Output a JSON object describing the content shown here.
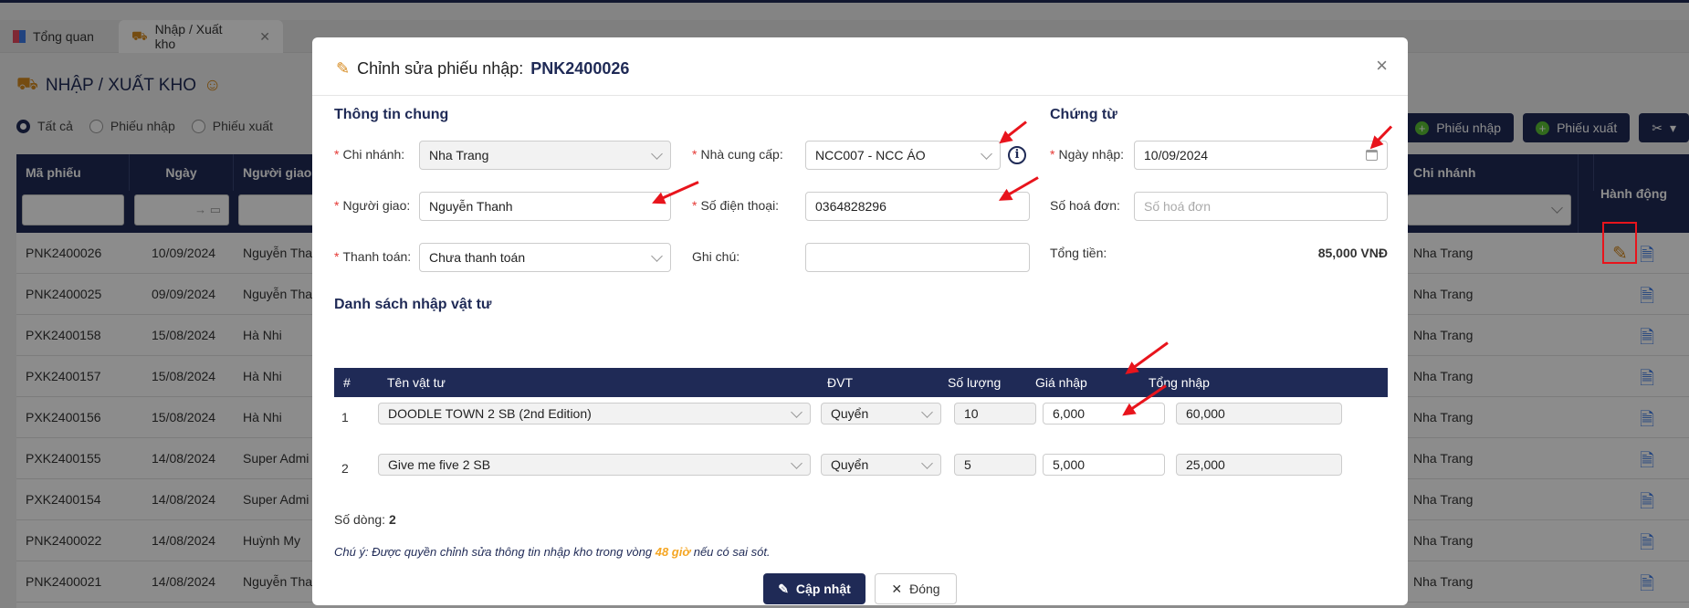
{
  "tabs": [
    {
      "label": "Tổng quan"
    },
    {
      "label": "Nhập / Xuất kho"
    }
  ],
  "page": {
    "title": "NHẬP / XUẤT KHO"
  },
  "filters": {
    "radio_all": "Tất cả",
    "radio_import": "Phiếu nhập",
    "radio_export": "Phiếu xuất"
  },
  "toolbar": {
    "import_label": "Phiếu nhập",
    "export_label": "Phiếu xuất"
  },
  "table": {
    "columns": [
      "Mã phiếu",
      "Ngày",
      "Người giao",
      "Chi nhánh",
      "Hành động"
    ],
    "rows": [
      {
        "code": "PNK2400026",
        "date": "10/09/2024",
        "person": "Nguyễn Tha",
        "branch": "Nha Trang"
      },
      {
        "code": "PNK2400025",
        "date": "09/09/2024",
        "person": "Nguyễn Tha",
        "branch": "Nha Trang"
      },
      {
        "code": "PXK2400158",
        "date": "15/08/2024",
        "person": "Hà Nhi",
        "branch": "Nha Trang"
      },
      {
        "code": "PXK2400157",
        "date": "15/08/2024",
        "person": "Hà Nhi",
        "branch": "Nha Trang"
      },
      {
        "code": "PXK2400156",
        "date": "15/08/2024",
        "person": "Hà Nhi",
        "branch": "Nha Trang"
      },
      {
        "code": "PXK2400155",
        "date": "14/08/2024",
        "person": "Super Admi",
        "branch": "Nha Trang"
      },
      {
        "code": "PXK2400154",
        "date": "14/08/2024",
        "person": "Super Admi",
        "branch": "Nha Trang"
      },
      {
        "code": "PNK2400022",
        "date": "14/08/2024",
        "person": "Huỳnh My",
        "branch": "Nha Trang"
      },
      {
        "code": "PNK2400021",
        "date": "14/08/2024",
        "person": "Nguyễn Tha",
        "branch": "Nha Trang"
      }
    ]
  },
  "modal": {
    "title": "Chỉnh sửa phiếu nhập:",
    "code": "PNK2400026",
    "section_general": "Thông tin chung",
    "section_docs": "Chứng từ",
    "labels": {
      "branch": "Chi nhánh:",
      "supplier": "Nhà cung cấp:",
      "date": "Ngày nhập:",
      "deliverer": "Người giao:",
      "phone": "Số điện thoại:",
      "invoice": "Số hoá đơn:",
      "payment": "Thanh toán:",
      "note": "Ghi chú:",
      "total": "Tổng tiền:"
    },
    "values": {
      "branch": "Nha Trang",
      "supplier": "NCC007 - NCC ÁO",
      "date": "10/09/2024",
      "deliverer": "Nguyễn Thanh",
      "phone": "0364828296",
      "invoice_placeholder": "Số hoá đơn",
      "payment": "Chưa thanh toán",
      "note": "",
      "total": "85,000 VNĐ"
    },
    "items_title": "Danh sách nhập vật tư",
    "items_columns": [
      "#",
      "Tên vật tư",
      "ĐVT",
      "Số lượng",
      "Giá nhập",
      "Tổng nhập"
    ],
    "items": [
      {
        "no": "1",
        "name": "DOODLE TOWN 2 SB (2nd Edition)",
        "unit": "Quyển",
        "qty": "10",
        "price": "6,000",
        "total": "60,000"
      },
      {
        "no": "2",
        "name": "Give me five 2 SB",
        "unit": "Quyển",
        "qty": "5",
        "price": "5,000",
        "total": "25,000"
      }
    ],
    "row_count_label": "Số dòng:",
    "row_count": "2",
    "note_prefix": "Chú ý: Được quyền chỉnh sửa thông tin nhập kho trong vòng",
    "note_hours": "48 giờ",
    "note_suffix": "nếu có sai sót.",
    "update_label": "Cập nhật",
    "close_label": "Đóng"
  },
  "colors": {
    "primary": "#1f2a56",
    "annotation": "#e8141c",
    "highlight": "#f5a623"
  }
}
